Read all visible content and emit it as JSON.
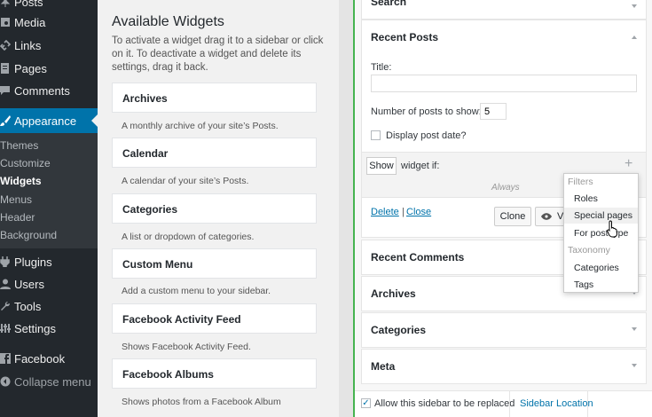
{
  "admin_menu": {
    "items_top": [
      {
        "label": "Posts",
        "icon": "pin-icon"
      },
      {
        "label": "Media",
        "icon": "media-icon"
      },
      {
        "label": "Links",
        "icon": "link-icon"
      },
      {
        "label": "Pages",
        "icon": "page-icon"
      },
      {
        "label": "Comments",
        "icon": "comment-icon"
      }
    ],
    "current": {
      "label": "Appearance",
      "icon": "brush-icon"
    },
    "submenu": [
      "Themes",
      "Customize",
      "Widgets",
      "Menus",
      "Header",
      "Background"
    ],
    "submenu_active": "Widgets",
    "items_bottom": [
      {
        "label": "Plugins",
        "icon": "plugin-icon"
      },
      {
        "label": "Users",
        "icon": "user-icon"
      },
      {
        "label": "Tools",
        "icon": "wrench-icon"
      },
      {
        "label": "Settings",
        "icon": "settings-icon"
      },
      {
        "label": "Facebook",
        "icon": "facebook-icon"
      },
      {
        "label": "Collapse menu",
        "icon": "collapse-icon"
      }
    ]
  },
  "available": {
    "heading": "Available Widgets",
    "description": "To activate a widget drag it to a sidebar or click on it. To deactivate a widget and delete its settings, drag it back.",
    "widgets": [
      {
        "name": "Archives",
        "desc": "A monthly archive of your site’s Posts."
      },
      {
        "name": "Calendar",
        "desc": "A calendar of your site’s Posts."
      },
      {
        "name": "Categories",
        "desc": "A list or dropdown of categories."
      },
      {
        "name": "Custom Menu",
        "desc": "Add a custom menu to your sidebar."
      },
      {
        "name": "Facebook Activity Feed",
        "desc": "Shows Facebook Activity Feed."
      },
      {
        "name": "Facebook Albums",
        "desc": "Shows photos from a Facebook Album"
      }
    ]
  },
  "sidebar": {
    "top_row": "Search",
    "recent_posts": {
      "title": "Recent Posts",
      "title_label": "Title:",
      "title_value": "",
      "number_label": "Number of posts to show:",
      "number_value": "5",
      "date_label": "Display post date?",
      "show_select": "Show",
      "widget_if": "widget if:",
      "always": "Always",
      "delete": "Delete",
      "separator": "|",
      "close": "Close",
      "clone": "Clone",
      "visibility_partial": "V"
    },
    "rows": [
      "Recent Comments",
      "Archives",
      "Categories",
      "Meta"
    ],
    "replace_label": "Allow this sidebar to be replaced",
    "location_link": "Sidebar Location"
  },
  "dropdown": {
    "heading_filters": "Filters",
    "filters": [
      "Roles",
      "Special pages",
      "For post type"
    ],
    "hover_item": "Special pages",
    "heading_taxonomy": "Taxonomy",
    "taxonomy": [
      "Categories",
      "Tags"
    ]
  },
  "colors": {
    "accent": "#0073aa",
    "active_border": "#46b450",
    "menu_bg": "#23282d"
  }
}
